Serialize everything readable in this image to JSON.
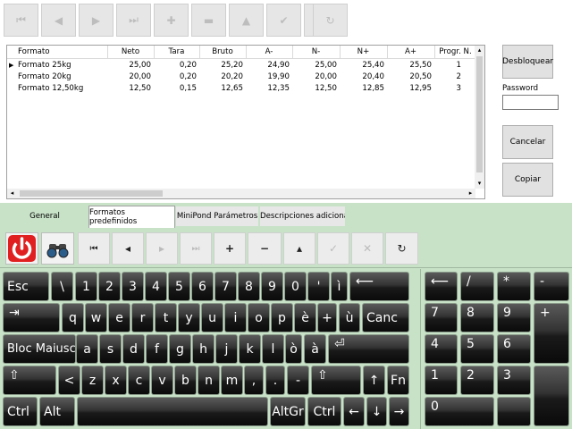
{
  "toolbar_top": {
    "buttons": [
      "first",
      "prev",
      "next",
      "last",
      "refresh",
      "delete",
      "up",
      "ok",
      "cancel",
      "reload"
    ]
  },
  "grid": {
    "columns": [
      "Formato",
      "Neto",
      "Tara",
      "Bruto",
      "A-",
      "N-",
      "N+",
      "A+",
      "Progr. N."
    ],
    "rows": [
      {
        "marker": "▶",
        "cells": [
          "Formato 25kg",
          "25,00",
          "0,20",
          "25,20",
          "24,90",
          "25,00",
          "25,40",
          "25,50",
          "1"
        ]
      },
      {
        "marker": "",
        "cells": [
          "Formato 20kg",
          "20,00",
          "0,20",
          "20,20",
          "19,90",
          "20,00",
          "20,40",
          "20,50",
          "2"
        ]
      },
      {
        "marker": "",
        "cells": [
          "Formato 12,50kg",
          "12,50",
          "0,15",
          "12,65",
          "12,35",
          "12,50",
          "12,85",
          "12,95",
          "3"
        ]
      }
    ]
  },
  "side": {
    "unlock_label": "Desbloquear",
    "password_label": "Password",
    "password_value": "",
    "cancel_label": "Cancelar",
    "copy_label": "Copiar"
  },
  "tabs": [
    "General",
    "Formatos predefinidos",
    "MiniPond Parámetros",
    "Descripciones adicionales"
  ],
  "active_tab": "Formatos predefinidos",
  "nav": {
    "first": "⏮",
    "prev": "◂",
    "next": "▸",
    "last": "⏭",
    "add": "+",
    "remove": "−",
    "up": "▴",
    "ok": "✓",
    "cancel": "✕",
    "refresh": "↻"
  },
  "keyboard": {
    "row1": [
      "Esc",
      "\\",
      "1",
      "2",
      "3",
      "4",
      "5",
      "6",
      "7",
      "8",
      "9",
      "0",
      "'",
      "ì",
      "⟵"
    ],
    "row2": [
      "⇥",
      "q",
      "w",
      "e",
      "r",
      "t",
      "y",
      "u",
      "i",
      "o",
      "p",
      "è",
      "+",
      "ù",
      "Canc"
    ],
    "row3": [
      "Bloc Maiusc",
      "a",
      "s",
      "d",
      "f",
      "g",
      "h",
      "j",
      "k",
      "l",
      "ò",
      "à",
      "⏎"
    ],
    "row4": [
      "⇧",
      "<",
      "z",
      "x",
      "c",
      "v",
      "b",
      "n",
      "m",
      ",",
      ".",
      "-",
      "⇧",
      "↑",
      "Fn"
    ],
    "row5": [
      "Ctrl",
      "Alt",
      "",
      "AltGr",
      "Ctrl",
      "←",
      "↓",
      "→"
    ],
    "numpad": [
      "⟵",
      "/",
      "*",
      "-",
      "7",
      "8",
      "9",
      "+",
      "4",
      "5",
      "6",
      "1",
      "2",
      "3",
      "",
      "0",
      ""
    ]
  },
  "colors": {
    "panel_green": "#c8e2c8",
    "power_red": "#e02020"
  }
}
